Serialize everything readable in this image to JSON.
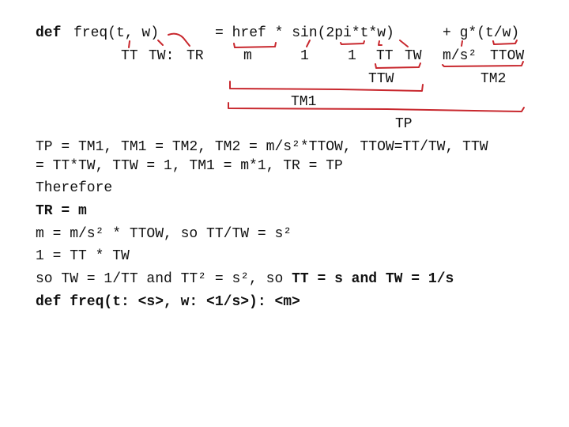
{
  "annotated_equation": {
    "def_keyword": "def",
    "signature": "freq(t, w)",
    "rhs": "= href * sin(2pi*t*w)",
    "rhs_tail": "+ g*(t/w)",
    "unit_labels": {
      "t": "TT",
      "w": "TW:",
      "return": "TR",
      "href": "m",
      "sin": "1",
      "two_pi": "1",
      "t_inner": "TT",
      "w_inner": "TW",
      "g": "m/s²",
      "t_over_w": "TTOW",
      "ttw": "TTW",
      "tm2": "TM2",
      "tm1": "TM1",
      "tp": "TP"
    }
  },
  "derivation": {
    "line1": "TP = TM1, TM1 = TM2, TM2 = m/s²*TTOW, TTOW=TT/TW, TTW",
    "line2": "= TT*TW, TTW = 1, TM1 = m*1, TR = TP",
    "therefore": "Therefore",
    "result": "TR = m",
    "line3": "m = m/s² * TTOW, so TT/TW = s²",
    "line4": "1 = TT * TW",
    "line5_plain": "so TW = 1/TT and TT² = s², so ",
    "line5_bold": "TT = s and TW = 1/s",
    "final": "def freq(t: <s>, w: <1/s>): <m>"
  }
}
